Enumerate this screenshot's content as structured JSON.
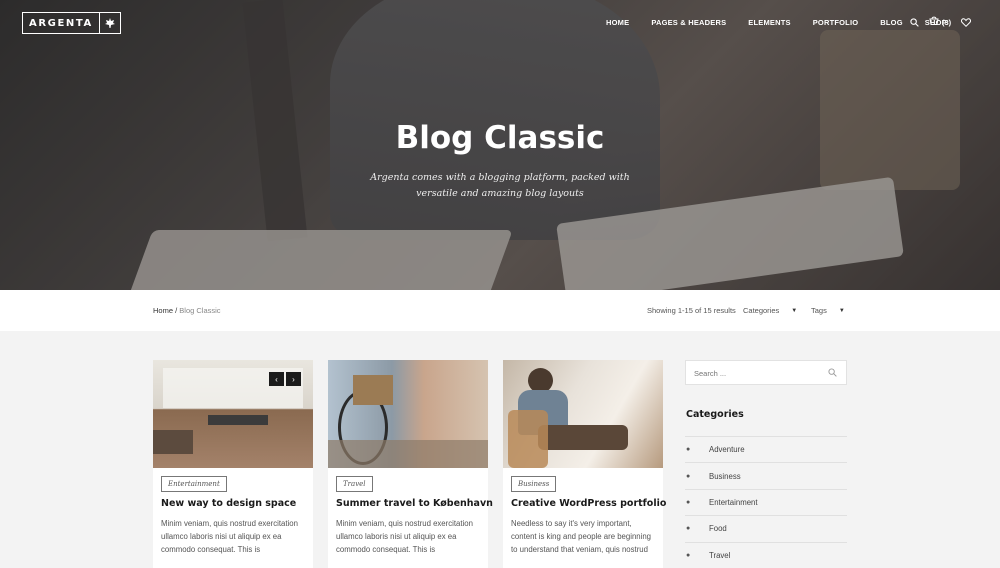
{
  "nav": {
    "logo": "ARGENTA",
    "items": [
      "HOME",
      "PAGES & HEADERS",
      "ELEMENTS",
      "PORTFOLIO",
      "BLOG",
      "SHOP"
    ],
    "cart_count": "(3)",
    "icons": [
      "search-icon",
      "cart-icon",
      "heart-icon"
    ]
  },
  "hero": {
    "title": "Blog Classic",
    "subtitle": "Argenta comes with a blogging platform, packed with versatile and amazing blog layouts"
  },
  "bar": {
    "breadcrumb_home": "Home",
    "breadcrumb_sep": "/",
    "breadcrumb_current": "Blog Classic",
    "results": "Showing 1-15 of 15 results",
    "categories_label": "Categories",
    "tags_label": "Tags"
  },
  "posts": [
    {
      "tag": "Entertainment",
      "title": "New way to design space",
      "excerpt": "Minim veniam, quis nostrud exercitation ullamco laboris nisi ut aliquip ex ea commodo consequat. This is"
    },
    {
      "tag": "Travel",
      "title": "Summer travel to København",
      "excerpt": "Minim veniam, quis nostrud exercitation ullamco laboris nisi ut aliquip ex ea commodo consequat. This is"
    },
    {
      "tag": "Business",
      "title": "Creative WordPress portfolio",
      "excerpt": "Needless to say it's very important, content is king and people are beginning to understand that veniam, quis nostrud"
    }
  ],
  "sidebar": {
    "search_placeholder": "Search ...",
    "categories_heading": "Categories",
    "categories": [
      "Adventure",
      "Business",
      "Entertainment",
      "Food",
      "Travel"
    ]
  },
  "colors": {
    "page_bg": "#f3f3f3",
    "card_bg": "#ffffff",
    "text_dark": "#1a1a1a",
    "nav_text": "#ffffff"
  }
}
